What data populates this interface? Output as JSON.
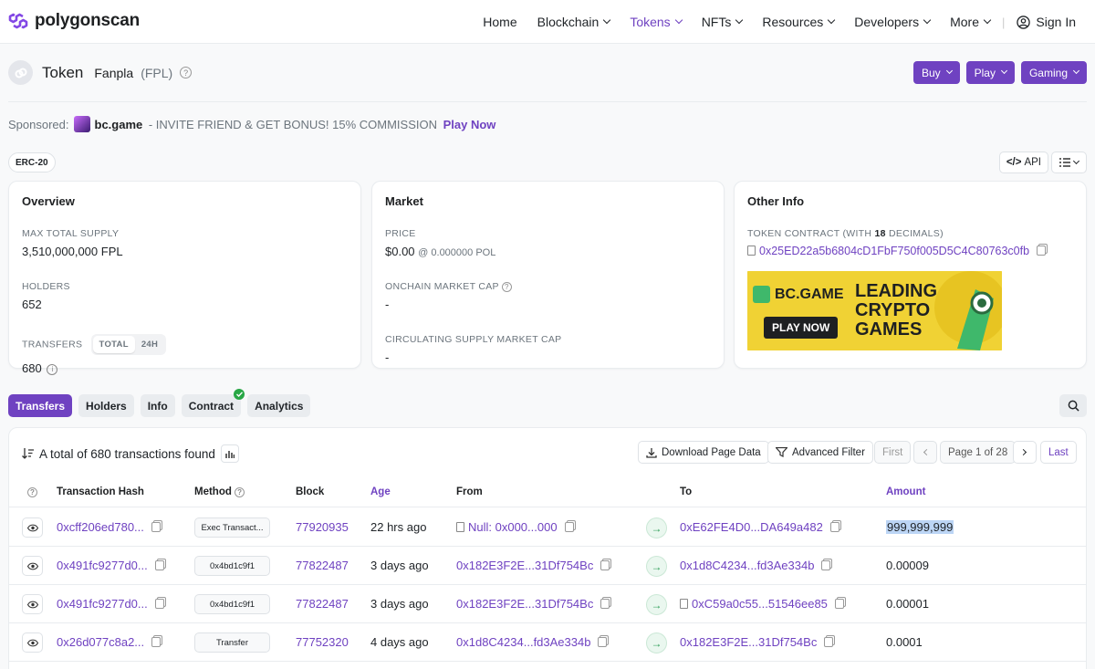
{
  "header": {
    "logo_text": "polygonscan",
    "nav": [
      {
        "label": "Home",
        "dropdown": false
      },
      {
        "label": "Blockchain",
        "dropdown": true
      },
      {
        "label": "Tokens",
        "dropdown": true,
        "active": true
      },
      {
        "label": "NFTs",
        "dropdown": true
      },
      {
        "label": "Resources",
        "dropdown": true
      },
      {
        "label": "Developers",
        "dropdown": true
      },
      {
        "label": "More",
        "dropdown": true
      }
    ],
    "sign_in": "Sign In"
  },
  "token": {
    "title": "Token",
    "name": "Fanpla",
    "symbol": "(FPL)",
    "buttons": [
      "Buy",
      "Play",
      "Gaming"
    ]
  },
  "sponsor": {
    "label": "Sponsored:",
    "brand": "bc.game",
    "text": " - INVITE FRIEND & GET BONUS! 15% COMMISSION ",
    "cta": "Play Now"
  },
  "badge": "ERC-20",
  "api_label": "API",
  "overview": {
    "title": "Overview",
    "max_supply_label": "MAX TOTAL SUPPLY",
    "max_supply": "3,510,000,000 FPL",
    "holders_label": "HOLDERS",
    "holders": "652",
    "transfers_label": "TRANSFERS",
    "toggle_total": "TOTAL",
    "toggle_24h": "24H",
    "transfers": "680"
  },
  "market": {
    "title": "Market",
    "price_label": "PRICE",
    "price": "$0.00",
    "price_pol": "@ 0.000000 POL",
    "onchain_label": "ONCHAIN MARKET CAP",
    "onchain": "-",
    "circ_label": "CIRCULATING SUPPLY MARKET CAP",
    "circ": "-"
  },
  "other": {
    "title": "Other Info",
    "contract_label_pre": "TOKEN CONTRACT (WITH ",
    "decimals": "18",
    "contract_label_post": " DECIMALS)",
    "contract": "0x25ED22a5b6804cD1FbF750f005D5C4C80763c0fb",
    "ad_brand": "BC.GAME",
    "ad_line1": "LEADING",
    "ad_line2": "CRYPTO",
    "ad_line3": "GAMES",
    "ad_cta": "PLAY NOW"
  },
  "tabs": [
    "Transfers",
    "Holders",
    "Info",
    "Contract",
    "Analytics"
  ],
  "table": {
    "summary": "A total of 680 transactions found",
    "download": "Download Page Data",
    "filter": "Advanced Filter",
    "first": "First",
    "page": "Page 1 of 28",
    "last": "Last",
    "columns": [
      "Transaction Hash",
      "Method",
      "Block",
      "Age",
      "From",
      "To",
      "Amount"
    ],
    "rows": [
      {
        "hash": "0xcff206ed780...",
        "method": "Exec Transact...",
        "block": "77920935",
        "age": "22 hrs ago",
        "from": "Null: 0x000...000",
        "from_doc": true,
        "to": "0xE62FE4D0...DA649a482",
        "to_doc": false,
        "amount": "999,999,999"
      },
      {
        "hash": "0x491fc9277d0...",
        "method": "0x4bd1c9f1",
        "block": "77822487",
        "age": "3 days ago",
        "from": "0x182E3F2E...31Df754Bc",
        "from_doc": false,
        "to": "0x1d8C4234...fd3Ae334b",
        "to_doc": false,
        "amount": "0.00009"
      },
      {
        "hash": "0x491fc9277d0...",
        "method": "0x4bd1c9f1",
        "block": "77822487",
        "age": "3 days ago",
        "from": "0x182E3F2E...31Df754Bc",
        "from_doc": false,
        "to": "0xC59a0c55...51546ee85",
        "to_doc": true,
        "amount": "0.00001"
      },
      {
        "hash": "0x26d077c8a2...",
        "method": "Transfer",
        "block": "77752320",
        "age": "4 days ago",
        "from": "0x1d8C4234...fd3Ae334b",
        "from_doc": false,
        "to": "0x182E3F2E...31Df754Bc",
        "to_doc": false,
        "amount": "0.0001"
      }
    ]
  },
  "colors": {
    "accent": "#6f42c1",
    "success": "#28a745"
  }
}
